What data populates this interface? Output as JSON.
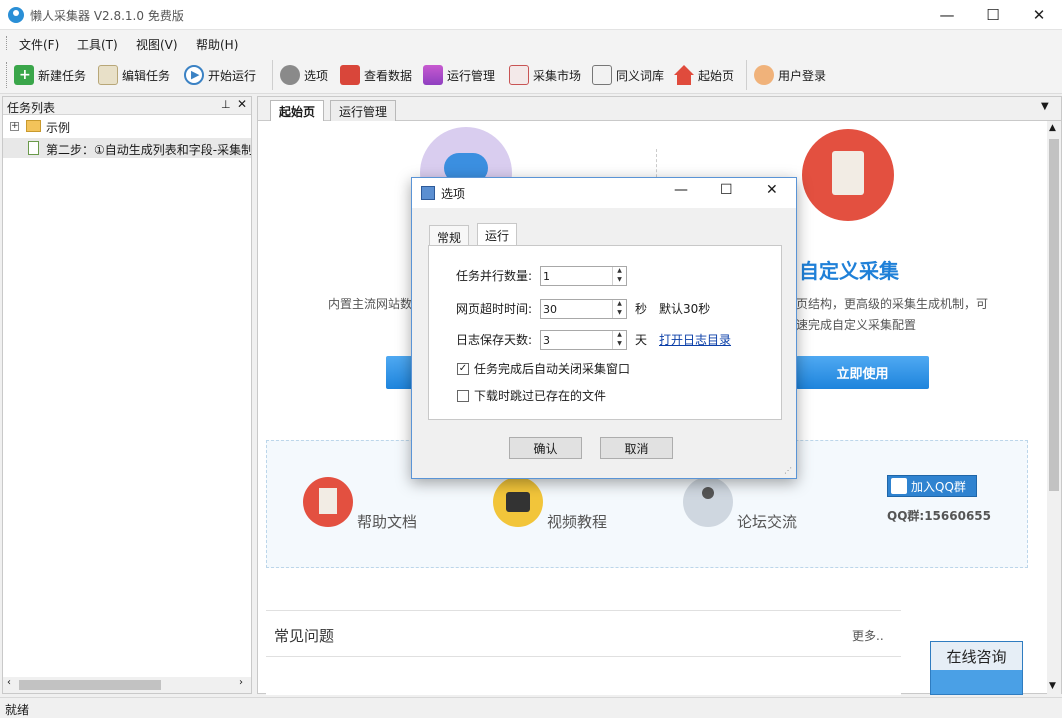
{
  "window": {
    "title": "懒人采集器 V2.8.1.0 免费版"
  },
  "menu": [
    "文件(F)",
    "工具(T)",
    "视图(V)",
    "帮助(H)"
  ],
  "toolbar": {
    "new_task": "新建任务",
    "edit_task": "编辑任务",
    "start_run": "开始运行",
    "options": "选项",
    "view_data": "查看数据",
    "run_manage": "运行管理",
    "market": "采集市场",
    "synonyms": "同义词库",
    "home": "起始页",
    "login": "用户登录"
  },
  "task_panel": {
    "title": "任务列表",
    "tree": [
      {
        "label": "示例"
      },
      {
        "label": "第二步：①自动生成列表和字段-采集制"
      }
    ]
  },
  "tabs": [
    "起始页",
    "运行管理"
  ],
  "home": {
    "left_desc": "内置主流网站数",
    "right_title": "自定义采集",
    "right_desc1": "页结构，更高级的采集生成机制，可",
    "right_desc2": "速完成自定义采集配置",
    "use_now": "立即使用",
    "help_docs": "帮助文档",
    "video_tutorial": "视频教程",
    "forum": "论坛交流",
    "join_qq": "加入QQ群",
    "qq_group": "QQ群:15660655",
    "faq_title": "常见问题",
    "more": "更多..",
    "online_consult": "在线咨询"
  },
  "status": "就绪",
  "dialog": {
    "title": "选项",
    "tabs": [
      "常规",
      "运行"
    ],
    "active_tab": "运行",
    "parallel_label": "任务并行数量:",
    "parallel_value": "1",
    "timeout_label": "网页超时时间:",
    "timeout_value": "30",
    "timeout_unit": "秒",
    "timeout_default": "默认30秒",
    "logdays_label": "日志保存天数:",
    "logdays_value": "3",
    "logdays_unit": "天",
    "open_log": "打开日志目录",
    "auto_close_label": "任务完成后自动关闭采集窗口",
    "auto_close_checked": true,
    "skip_existing_label": "下载时跳过已存在的文件",
    "skip_existing_checked": false,
    "ok": "确认",
    "cancel": "取消"
  }
}
